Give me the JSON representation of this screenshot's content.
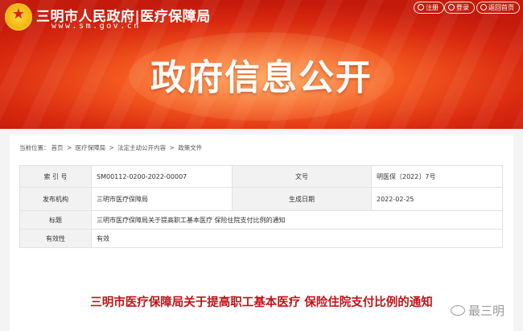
{
  "header": {
    "site_name": "三明市人民政府|医疗保障局",
    "site_url": "www.sm.gov.cn",
    "links": [
      {
        "label": "注册",
        "icon": "person-icon"
      },
      {
        "label": "登录",
        "icon": "person-icon"
      },
      {
        "label": "返回首页",
        "icon": "home-icon"
      }
    ],
    "banner_title": "政府信息公开",
    "colors": {
      "banner_red": "#d9290f",
      "banner_orange": "#f2561e",
      "title_red": "#c0131a"
    }
  },
  "breadcrumb": {
    "prefix": "当前位置：",
    "items": [
      "首页",
      "医疗保障局",
      "法定主动公开内容",
      "政策文件"
    ],
    "separator": ">"
  },
  "meta": {
    "index_label": "索 引 号",
    "index_value": "SM00112-0200-2022-00007",
    "docno_label": "文号",
    "docno_value": "明医保〔2022〕7号",
    "issuer_label": "发布机构",
    "issuer_value": "三明市医疗保障局",
    "date_label": "生成日期",
    "date_value": "2022-02-25",
    "title_label": "标题",
    "title_value": "三明市医疗保障局关于提高职工基本医疗 保险住院支付比例的通知",
    "validity_label": "有效性",
    "validity_value": "有效"
  },
  "document": {
    "title": "三明市医疗保障局关于提高职工基本医疗 保险住院支付比例的通知"
  },
  "watermark": {
    "text": "最三明",
    "icon": "wechat-icon"
  }
}
